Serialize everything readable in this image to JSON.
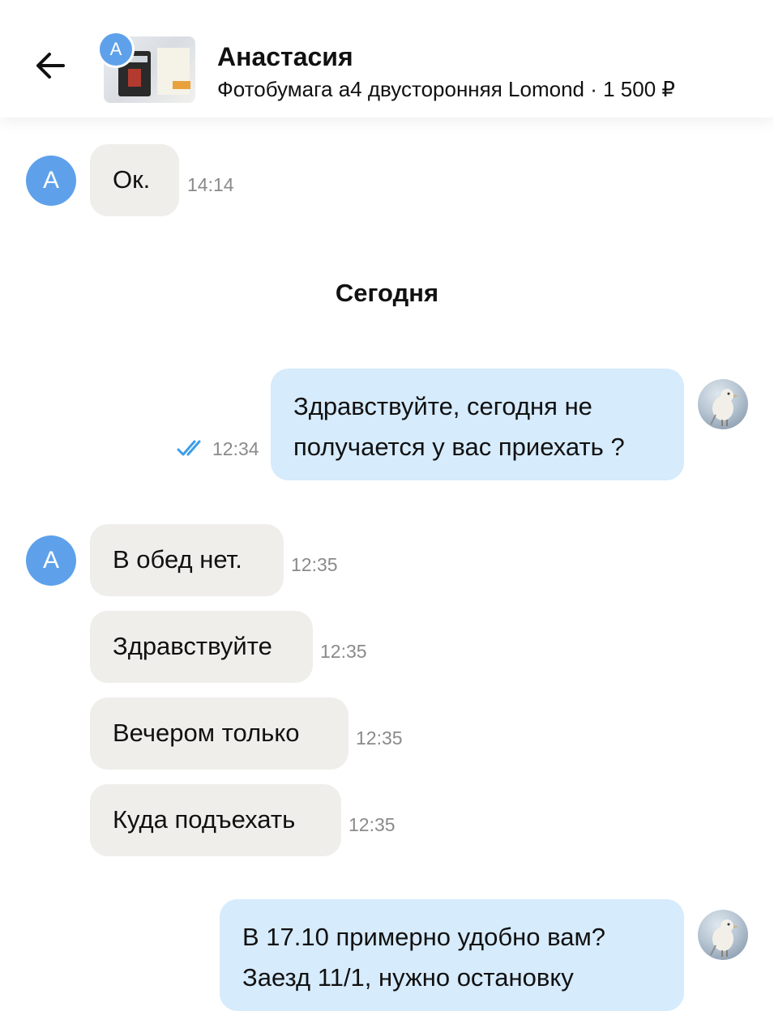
{
  "header": {
    "contact_name": "Анастасия",
    "listing": "Фотобумага а4 двусторонняя Lomond · 1 500 ₽",
    "avatar_letter": "А",
    "back_icon": "arrow-left-icon"
  },
  "date_separator": "Сегодня",
  "messages": [
    {
      "direction": "incoming",
      "text": "Ок.",
      "time": "14:14",
      "avatar_letter": "А"
    },
    {
      "direction": "outgoing",
      "lines": [
        "Здравствуйте, сегодня не",
        "получается у вас приехать ?"
      ],
      "time": "12:34",
      "status": "read"
    },
    {
      "direction": "incoming",
      "text": "В обед нет.",
      "time": "12:35",
      "avatar_letter": "А"
    },
    {
      "direction": "incoming",
      "text": "Здравствуйте",
      "time": "12:35"
    },
    {
      "direction": "incoming",
      "text": "Вечером только",
      "time": "12:35"
    },
    {
      "direction": "incoming",
      "text": "Куда подъехать",
      "time": "12:35"
    },
    {
      "direction": "outgoing",
      "lines": [
        "В 17.10 примерно удобно вам?",
        "Заезд 11/1, нужно остановку"
      ],
      "time": "",
      "status": ""
    }
  ],
  "colors": {
    "incoming_bubble": "#efeeea",
    "outgoing_bubble": "#d6ebfc",
    "avatar_blue": "#5ea1ea",
    "read_check": "#3c9de8"
  }
}
